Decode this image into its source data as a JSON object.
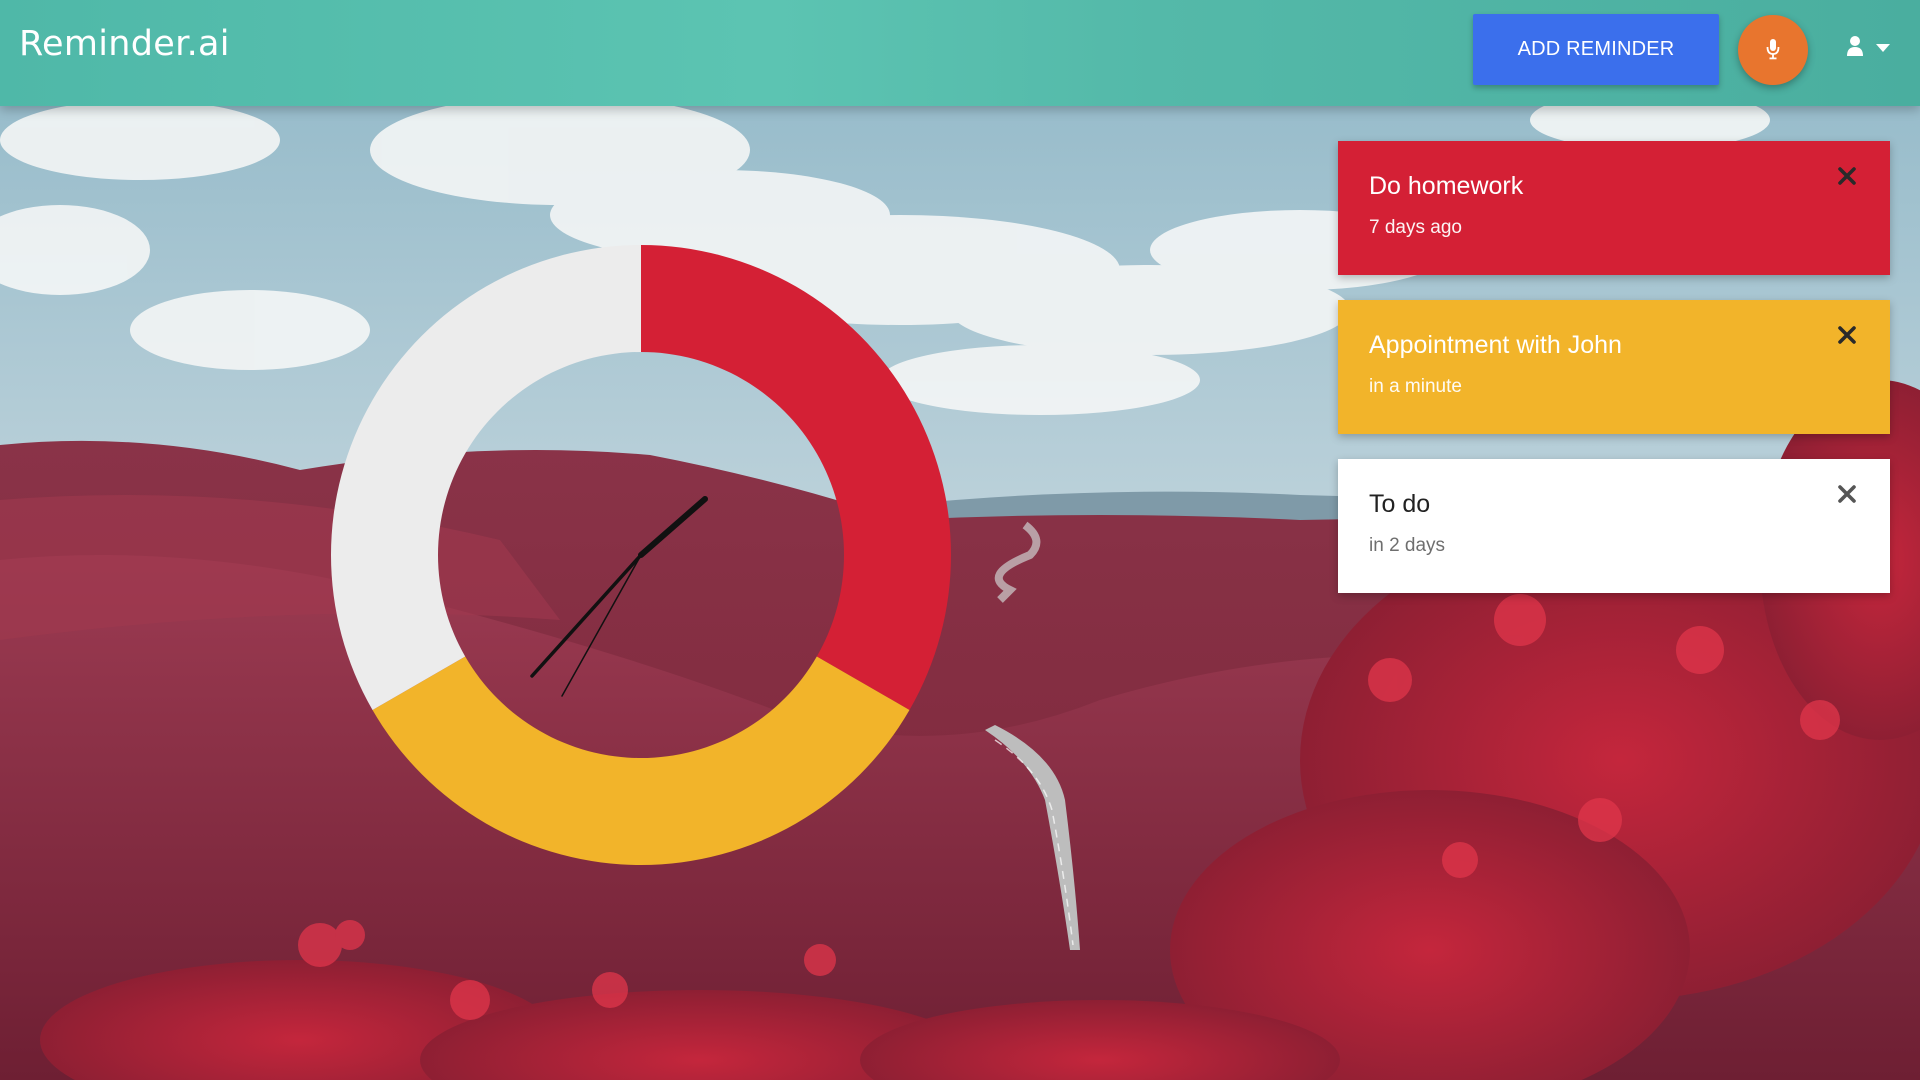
{
  "app": {
    "title": "Reminder.ai"
  },
  "toolbar": {
    "add_reminder_label": "ADD REMINDER",
    "mic_icon": "microphone-icon",
    "user_icon": "user-icon",
    "dropdown_icon": "caret-down-icon"
  },
  "colors": {
    "topbar": "#55bcab",
    "add_button": "#3b6fec",
    "mic_button": "#e8752e",
    "overdue": "#d42035",
    "soon": "#f2b42a",
    "upcoming": "#ffffff",
    "clock_empty": "#ececec"
  },
  "clock": {
    "segments": [
      {
        "name": "overdue",
        "color": "#d42035",
        "start_deg": 0,
        "end_deg": 120
      },
      {
        "name": "soon",
        "color": "#f2b42a",
        "start_deg": 120,
        "end_deg": 240
      },
      {
        "name": "empty",
        "color": "#ececec",
        "start_deg": 240,
        "end_deg": 360
      }
    ]
  },
  "reminders": [
    {
      "title": "Do homework",
      "time": "7 days ago",
      "status": "overdue",
      "bg": "#d42035",
      "text_color": "#ffffff",
      "close_color": "#2a2a2a"
    },
    {
      "title": "Appointment with John",
      "time": "in a minute",
      "status": "soon",
      "bg": "#f2b42a",
      "text_color": "#ffffff",
      "close_color": "#2a2a2a"
    },
    {
      "title": "To do",
      "time": "in 2 days",
      "status": "upcoming",
      "bg": "#ffffff",
      "text_color": "#222222",
      "close_color": "#555555"
    }
  ]
}
